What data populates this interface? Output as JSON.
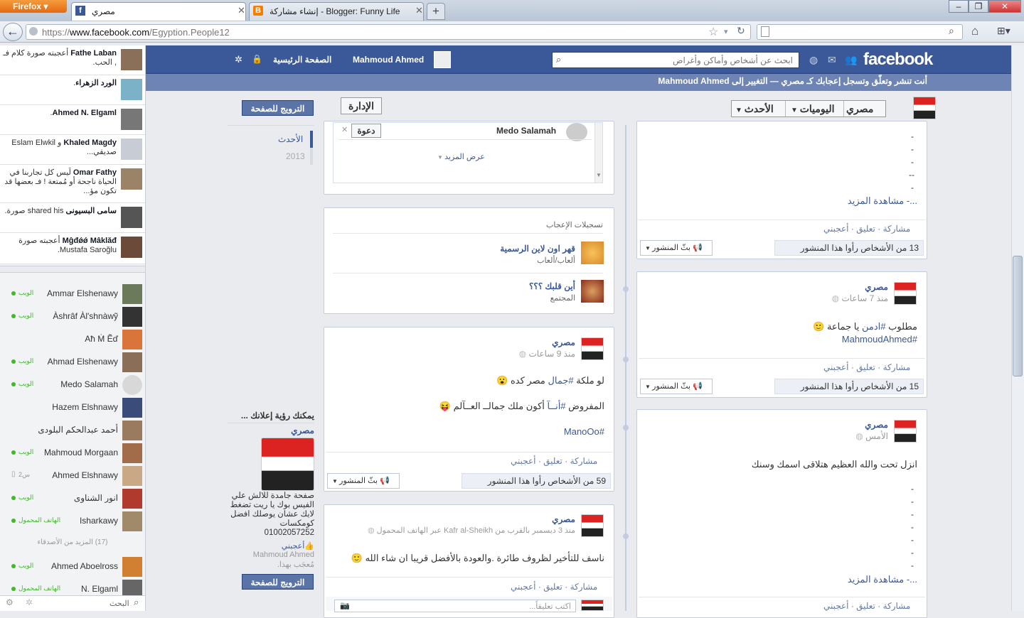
{
  "browser": {
    "app": "Firefox",
    "tabs": [
      {
        "title": "مصري",
        "active": true
      },
      {
        "title": "Blogger: Funny Life - إنشاء مشاركة",
        "active": false
      }
    ],
    "url": "https://www.facebook.com/Egyption.People12",
    "url_host": "www.facebook.com",
    "url_path": "/Egyption.People12"
  },
  "fb": {
    "logo": "facebook",
    "search_placeholder": "ابحث عن أشخاص وأماكن وأغراض",
    "user": "Mahmoud Ahmed",
    "home": "الصفحة الرئيسية",
    "notice_prefix": "أنت تنشر وتعلّق وتسجل إعجابك كـ مصري — ",
    "notice_link": "التغيير إلى Mahmoud Ahmed"
  },
  "ticker": [
    {
      "name": "Fathe Laban",
      "text": "أعجبته صورة كلام فـ , الحب."
    },
    {
      "name": "الورد الزهراء",
      "text": "."
    },
    {
      "name": "Ahmed N. Elgaml",
      "text": "."
    },
    {
      "name": "Khaled Magdy",
      "text": "و Eslam Elwkil صديقي..."
    },
    {
      "name": "Omar Fathy",
      "text": "لَيس كل تجاربنا في الحياة ناجحة أو مُمتعة ! فـ بعضها قد تكون مؤ..."
    },
    {
      "name": "سامى البسيونى",
      "text": "shared his صورة."
    },
    {
      "name": "Mĝđǿǿ Mâklăđ",
      "text": "أعجبته صورة Mustafa Saroğlu."
    }
  ],
  "chat": [
    {
      "name": "Ammar Elshenawy",
      "status": "الويب",
      "online": true
    },
    {
      "name": "Àshrâf Àl'shnàwỹ",
      "status": "الويب",
      "online": true
    },
    {
      "name": "Aħ Ṁ Ẽď",
      "status": "",
      "online": false
    },
    {
      "name": "Ahmad Elshenawy",
      "status": "الويب",
      "online": true
    },
    {
      "name": "Medo Salamah",
      "status": "الويب",
      "online": true
    },
    {
      "name": "Hazem Elshnawy",
      "status": "",
      "online": false
    },
    {
      "name": "أحمد عبدالحكم البلودى",
      "status": "",
      "online": false
    },
    {
      "name": "Mahmoud Morgaan",
      "status": "الويب",
      "online": true
    },
    {
      "name": "Ahmed Elshnawy",
      "status": "2س",
      "online": false
    },
    {
      "name": "انور الشناوى",
      "status": "الويب",
      "online": true
    },
    {
      "name": "Isharkawy",
      "status": "الهاتف المحمول",
      "online": true
    }
  ],
  "chat_more": "(17) المزيد من الأصدقاء",
  "chat_more2": [
    {
      "name": "Ahmed Aboelross",
      "status": "الويب",
      "online": true
    },
    {
      "name": "N. Elgaml",
      "status": "الهاتف المحمول",
      "online": true
    }
  ],
  "chat_search": "البحث",
  "page_header": {
    "name": "مصري",
    "timeline": "اليوميات",
    "sort": "الأحدث",
    "admin": "الإدارة",
    "promote": "الترويج للصفحة"
  },
  "years": {
    "recent": "الأحدث",
    "y2013": "2013"
  },
  "invite": {
    "name": "Medo Salamah",
    "btn": "دعوة",
    "more": "عرض المزيد"
  },
  "likes": {
    "title": "تسجيلات الإعجاب",
    "items": [
      {
        "name": "قهر اون لاين الرسمية",
        "cat": "ألعاب/ألعاب"
      },
      {
        "name": "أين قلبك ؟؟؟",
        "cat": "المجتمع"
      }
    ]
  },
  "ads": {
    "title": "يمكنك رؤية إعلانك ...",
    "page": "مصري",
    "desc": "صفحة جامدة للالش علي الفيس بوك يا ريت تضغط لايك عشان يوصلك افضل كومكسات 01002057252",
    "like": "أعجبني",
    "liker": "Mahmoud Ahmed",
    "liked": "مُعجَب بهذا.",
    "promote": "الترويج للصفحة"
  },
  "actions": {
    "like": "أعجبني",
    "comment": "تعليق",
    "share": "مشاركة",
    "broadcast": "بثّ المنشور"
  },
  "posts": {
    "p0": {
      "more": "...- مشاهدة المزيد",
      "seen": "13 من الأشخاص رأوا هذا المنشور"
    },
    "p1": {
      "name": "مصري",
      "time": "منذ 7 ساعات",
      "text1": "مطلوب ",
      "hashtag1": "#ادمن",
      "text1b": " يا جماعة",
      "hashtag2": "#MahmoudAhmed",
      "seen": "15 من الأشخاص رأوا هذا المنشور"
    },
    "p2": {
      "name": "مصري",
      "time": "منذ 9 ساعات",
      "line1a": "لو ملكة ",
      "line1h": "#جمال",
      "line1b": " مصر كده",
      "line2a": "المفروض ",
      "line2h": "#أنــآ",
      "line2b": " أكون ملك جمالــ العــآلم",
      "line3": "#ManoOo",
      "seen": "59 من الأشخاص رأوا هذا المنشور"
    },
    "p3": {
      "name": "مصري",
      "time": "الأمس",
      "text": "انزل تحت والله العظيم هتلاقى اسمك وسنك",
      "more": "...- مشاهدة المزيد"
    },
    "p4": {
      "name": "مصري",
      "time": "منذ 3 ديسمبر بالقرب من Kafr al-Sheikh عبر الهاتف المحمول",
      "text": "ناسف للتأخير لظروف طائرة .والعودة بالأفضل قريبا ان شاء الله",
      "comment_ph": "اكتب تعليقاً..."
    }
  }
}
